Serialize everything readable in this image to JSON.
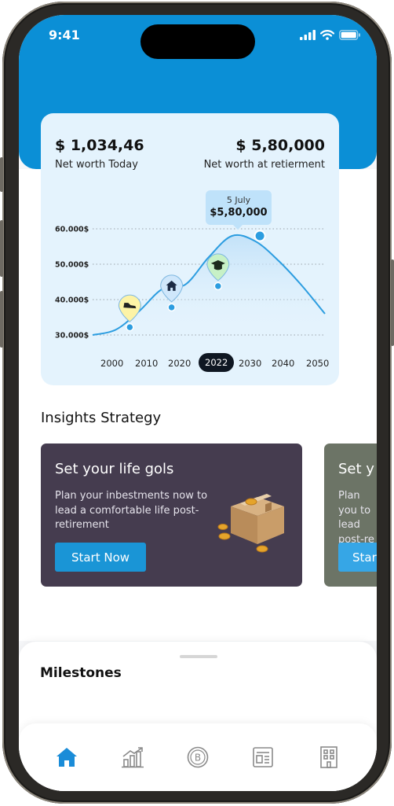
{
  "status_bar": {
    "time": "9:41"
  },
  "summary": {
    "net_worth_today_value": "$ 1,034,46",
    "net_worth_today_label": "Net worth Today",
    "net_worth_retirement_value": "$ 5,80,000",
    "net_worth_retirement_label": "Net worth at retierment"
  },
  "tooltip": {
    "date": "5 July",
    "value": "$5,80,000"
  },
  "chart_data": {
    "type": "line",
    "x": [
      2000,
      2005,
      2010,
      2015,
      2020,
      2025,
      2030,
      2035,
      2040,
      2045,
      2050
    ],
    "y": [
      30000,
      31500,
      36700,
      43000,
      44300,
      52000,
      58000,
      56500,
      51000,
      44000,
      36000
    ],
    "xtick_labels": [
      "2000",
      "2010",
      "2020",
      "2022",
      "2030",
      "2040",
      "2050"
    ],
    "selected_tick": "2022",
    "ytick_labels": [
      "60.000$",
      "50.000$",
      "40.000$",
      "30.000$"
    ],
    "ylim": [
      30000,
      60000
    ],
    "grid": "horizontal-dotted",
    "accent_color": "#2c9de0",
    "markers": [
      {
        "icon": "shoe-icon",
        "x": 2008,
        "y": 32200,
        "color": "#fdf3a6"
      },
      {
        "icon": "home-icon",
        "x": 2017,
        "y": 37800,
        "color": "#cfe7fb"
      },
      {
        "icon": "graduation-cap-icon",
        "x": 2027,
        "y": 43800,
        "color": "#c7f1c6"
      }
    ],
    "highlight_point": {
      "x": 2036,
      "y": 58000
    }
  },
  "insights": {
    "title": "Insights Strategy",
    "cards": [
      {
        "title": "Set your life gols",
        "body": "Plan your inbestments now to lead a comfortable life post-retirement",
        "button": "Start Now",
        "bg": "#453c4f"
      },
      {
        "title": "Set y",
        "body": "Plan you to lead post-re",
        "button": "Star",
        "bg": "#6c7466"
      }
    ]
  },
  "milestones": {
    "title": "Milestones"
  },
  "tabs": [
    {
      "icon": "home-icon",
      "active": true
    },
    {
      "icon": "chart-icon",
      "active": false
    },
    {
      "icon": "bitcoin-icon",
      "active": false
    },
    {
      "icon": "news-icon",
      "active": false
    },
    {
      "icon": "building-icon",
      "active": false
    }
  ],
  "colors": {
    "primary": "#0b8fd6",
    "active_tab": "#1a8cd8",
    "inactive_tab": "#8a8a8a"
  }
}
